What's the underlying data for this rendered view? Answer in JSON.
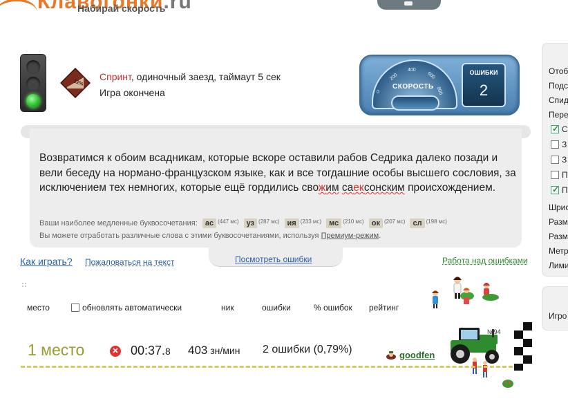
{
  "header": {
    "logo_text": "Клавогонки",
    "logo_suffix": ".ru",
    "tagline": "Набирай скорость"
  },
  "race": {
    "badge_value": "12%",
    "type_link": "Спринт",
    "type_desc": ", одиночный заезд, таймаут 5 сек",
    "status": "Игра окончена"
  },
  "dashboard": {
    "speed_label": "СКОРОСТЬ",
    "errors_label": "ОШИБКИ",
    "errors_value": "2",
    "ticks": [
      "0",
      "200",
      "400",
      "600",
      "800"
    ]
  },
  "text": {
    "part1": "Возвратимся к обоим всадникам, которые вскоре оставили рабов Седрика далеко позади и вели беседу на нормано-французском языке, как и все тогдашние особы высшего сословия, за исключением тех немногих, которые ещё гордились сво",
    "typo1_pre": "",
    "typo1_err": "ж",
    "typo1_post": "им",
    "part2": " ",
    "typo2_pre": "са",
    "typo2_err": "ек",
    "typo2_post": "сонским",
    "part3": " происхождением."
  },
  "slow": {
    "label": "Ваши наиболее медленные буквосочетания:",
    "combos": [
      {
        "c": "ас",
        "ms": "(447 мс)"
      },
      {
        "c": "уз",
        "ms": "(287 мс)"
      },
      {
        "c": "ия",
        "ms": "(233 мс)"
      },
      {
        "c": "мс",
        "ms": "(210 мс)"
      },
      {
        "c": "ок",
        "ms": "(207 мс)"
      },
      {
        "c": "сл",
        "ms": "(198 мс)"
      }
    ],
    "practice_text": "Вы можете отработать различные слова с этими буквосочетаниями, используя ",
    "practice_link": "Премиум-режим",
    "practice_end": "."
  },
  "links": {
    "how_to_play": "Как играть?",
    "complain": "Пожаловаться на текст",
    "view_errors": "Посмотреть ошибки",
    "work_on_errors": "Работа над ошибками"
  },
  "table_header": {
    "place": "место",
    "auto_update": "обновлять автоматически",
    "nick": "ник",
    "errors": "ошибки",
    "error_pct": "% ошибок",
    "rating": "рейтинг"
  },
  "result": {
    "place": "1 место",
    "time_main": "00:37.",
    "time_frac": "8",
    "speed": "403",
    "speed_unit": " зн/мин",
    "errors": "2 ошибки (0,79%)",
    "nick": "goodfen",
    "car_number": "№94"
  },
  "sidebar": {
    "items": [
      "Отоб",
      "Подс",
      "Спид",
      "Пере"
    ],
    "checkboxes": [
      {
        "label": "С",
        "checked": true
      },
      {
        "label": "З",
        "checked": false
      },
      {
        "label": "З",
        "checked": false
      },
      {
        "label": "П",
        "checked": false
      },
      {
        "label": "П",
        "checked": true
      }
    ],
    "items2": [
      "Шрис",
      "Разм",
      "Разм",
      "Метр",
      "Лими"
    ],
    "bottom": "Игро"
  },
  "colors": {
    "accent_orange": "#e8792b",
    "link_blue": "#2b5faa",
    "link_green": "#2b8a2b",
    "place_olive": "#9b9b33",
    "error_red": "#d33"
  }
}
